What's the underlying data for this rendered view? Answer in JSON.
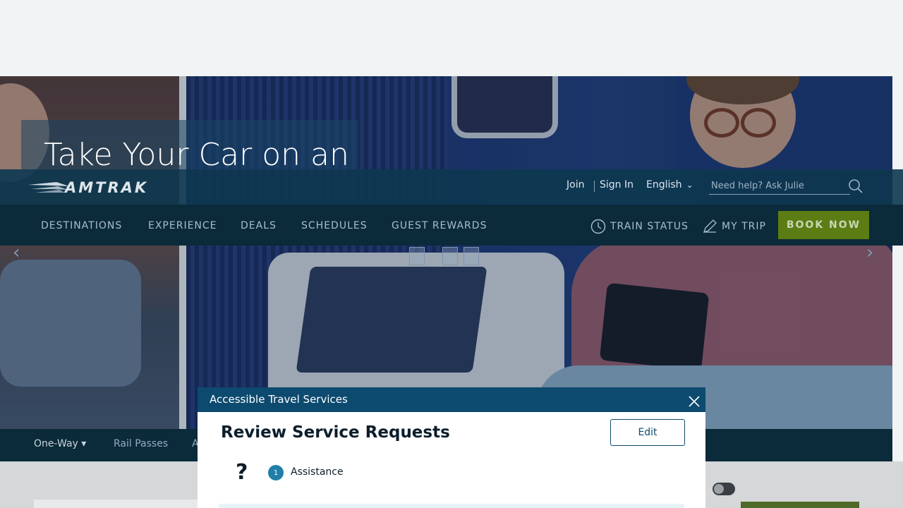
{
  "hero": {
    "title": "Take Your Car on an"
  },
  "header": {
    "logo_text": "AMTRAK",
    "join_label": "Join",
    "signin_label": "Sign In",
    "language_label": "English",
    "help_placeholder": "Need help? Ask Julie"
  },
  "nav": {
    "items": [
      "DESTINATIONS",
      "EXPERIENCE",
      "DEALS",
      "SCHEDULES",
      "GUEST REWARDS"
    ],
    "train_status_label": "TRAIN STATUS",
    "my_trip_label": "MY TRIP",
    "book_now_label": "BOOK NOW"
  },
  "booking": {
    "trip_type": "One-Way",
    "rail_passes_label": "Rail Passes",
    "partial_label": "A"
  },
  "modal": {
    "header_title": "Accessible Travel Services",
    "heading": "Review Service Requests",
    "edit_label": "Edit",
    "question_mark": "?",
    "step_number": "1",
    "assistance_label": "Assistance"
  },
  "colors": {
    "brand_navy": "#0d4a6f",
    "nav_dark": "#0b2a3a",
    "book_now_green": "#5b7d13"
  }
}
